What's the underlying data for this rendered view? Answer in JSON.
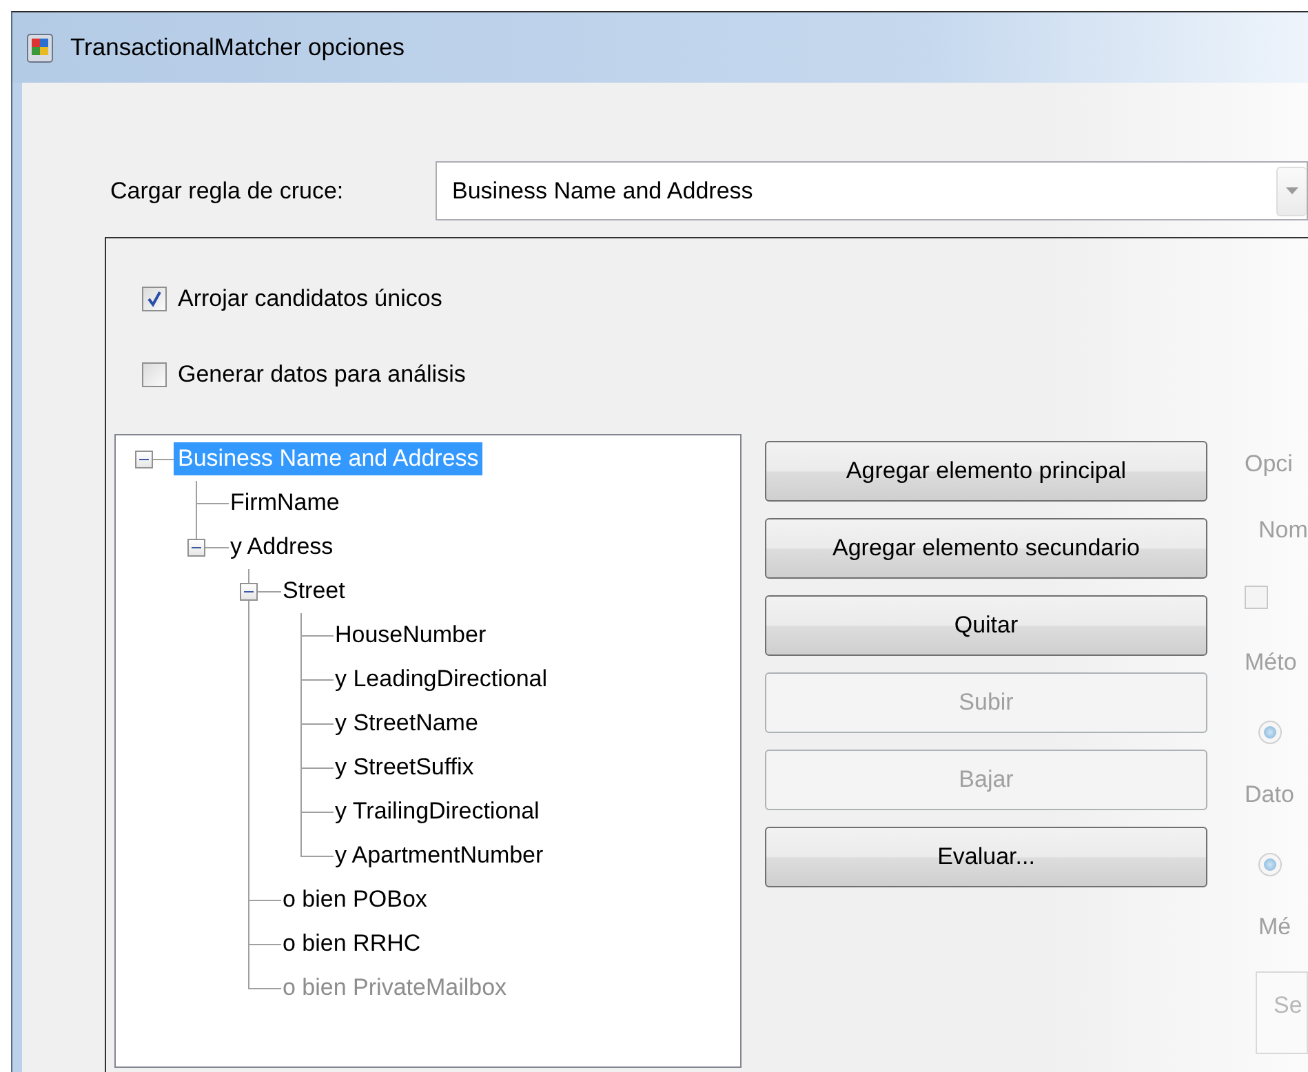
{
  "window": {
    "title": "TransactionalMatcher opciones"
  },
  "rule": {
    "label": "Cargar regla de cruce:",
    "value": "Business Name and Address"
  },
  "options": [
    {
      "label": "Arrojar candidatos únicos",
      "checked": true
    },
    {
      "label": "Generar datos para análisis",
      "checked": false
    }
  ],
  "tree": [
    {
      "label": "Business Name and Address",
      "selected": true,
      "disabled": false,
      "expanded": true,
      "children": [
        {
          "label": "FirmName",
          "selected": false,
          "disabled": false
        },
        {
          "label": "y Address",
          "selected": false,
          "disabled": false,
          "expanded": true,
          "children": [
            {
              "label": "Street",
              "selected": false,
              "disabled": false,
              "expanded": true,
              "children": [
                {
                  "label": "HouseNumber",
                  "selected": false,
                  "disabled": false
                },
                {
                  "label": "y LeadingDirectional",
                  "selected": false,
                  "disabled": false
                },
                {
                  "label": "y StreetName",
                  "selected": false,
                  "disabled": false
                },
                {
                  "label": "y StreetSuffix",
                  "selected": false,
                  "disabled": false
                },
                {
                  "label": "y TrailingDirectional",
                  "selected": false,
                  "disabled": false
                },
                {
                  "label": "y ApartmentNumber",
                  "selected": false,
                  "disabled": false
                }
              ]
            },
            {
              "label": "o bien POBox",
              "selected": false,
              "disabled": false
            },
            {
              "label": "o bien RRHC",
              "selected": false,
              "disabled": false
            },
            {
              "label": "o bien PrivateMailbox",
              "selected": false,
              "disabled": true
            }
          ]
        }
      ]
    }
  ],
  "buttons": [
    {
      "label": "Agregar elemento principal",
      "disabled": false
    },
    {
      "label": "Agregar elemento secundario",
      "disabled": false
    },
    {
      "label": "Quitar",
      "disabled": false
    },
    {
      "label": "Subir",
      "disabled": true
    },
    {
      "label": "Bajar",
      "disabled": true
    },
    {
      "label": "Evaluar...",
      "disabled": false
    }
  ],
  "right_panel": {
    "items": [
      {
        "kind": "label",
        "text": "Opci"
      },
      {
        "kind": "label",
        "text": "Nom"
      },
      {
        "kind": "checkbox",
        "checked": false
      },
      {
        "kind": "label",
        "text": "Méto"
      },
      {
        "kind": "radio",
        "selected": true
      },
      {
        "kind": "label",
        "text": "Dato"
      },
      {
        "kind": "radio",
        "selected": true
      },
      {
        "kind": "label",
        "text": "Mé"
      },
      {
        "kind": "field",
        "value": "Se"
      }
    ]
  }
}
